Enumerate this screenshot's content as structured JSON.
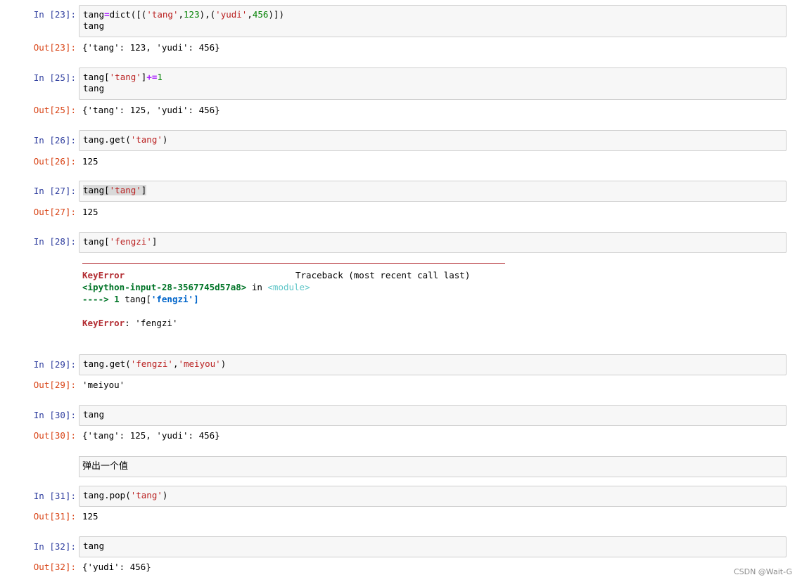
{
  "cells": {
    "c23": {
      "in_prompt": "In  [23]:",
      "line1": {
        "a": "tang",
        "op": "=",
        "b": "dict([(",
        "s1": "'tang'",
        "c": ",",
        "n1": "123",
        "d": "),(",
        "s2": "'yudi'",
        "e": ",",
        "n2": "456",
        "f": ")])"
      },
      "line2": "tang",
      "out_prompt": "Out[23]:",
      "output": "{'tang': 123, 'yudi': 456}"
    },
    "c25": {
      "in_prompt": "In  [25]:",
      "line1": {
        "a": "tang[",
        "s1": "'tang'",
        "b": "]",
        "op": "+=",
        "n1": "1"
      },
      "line2": "tang",
      "out_prompt": "Out[25]:",
      "output": "{'tang': 125, 'yudi': 456}"
    },
    "c26": {
      "in_prompt": "In  [26]:",
      "line1": {
        "a": "tang.get(",
        "s1": "'tang'",
        "b": ")"
      },
      "out_prompt": "Out[26]:",
      "output": "125"
    },
    "c27": {
      "in_prompt": "In  [27]:",
      "line1": {
        "a": "tang[",
        "s1": "'tang'",
        "b": "]"
      },
      "out_prompt": "Out[27]:",
      "output": "125"
    },
    "c28": {
      "in_prompt": "In  [28]:",
      "line1": {
        "a": "tang[",
        "s1": "'fengzi'",
        "b": "]"
      },
      "traceback": {
        "err_name": "KeyError",
        "tb_label": "Traceback (most recent call last)",
        "ipy_input": "<ipython-input-28-3567745d57a8>",
        "in_word": " in ",
        "module": "<module>",
        "arrow": "---->",
        "lineno": " 1 ",
        "code_a": "tang[",
        "code_s": "'fengzi'",
        "code_b": "]",
        "final_msg": ": 'fengzi'"
      }
    },
    "c29": {
      "in_prompt": "In  [29]:",
      "line1": {
        "a": "tang.get(",
        "s1": "'fengzi'",
        "c": ",",
        "s2": "'meiyou'",
        "b": ")"
      },
      "out_prompt": "Out[29]:",
      "output": "'meiyou'"
    },
    "c30": {
      "in_prompt": "In  [30]:",
      "line1": "tang",
      "out_prompt": "Out[30]:",
      "output": "{'tang': 125, 'yudi': 456}"
    },
    "markdown": "弹出一个值",
    "c31": {
      "in_prompt": "In  [31]:",
      "line1": {
        "a": "tang.pop(",
        "s1": "'tang'",
        "b": ")"
      },
      "out_prompt": "Out[31]:",
      "output": "125"
    },
    "c32": {
      "in_prompt": "In  [32]:",
      "line1": "tang",
      "out_prompt": "Out[32]:",
      "output": "{'yudi': 456}"
    }
  },
  "watermark": "CSDN @Wait-G",
  "colors": {
    "in_prompt": "#303f9f",
    "out_prompt": "#d84315",
    "string": "#ba2121",
    "number": "#008000",
    "operator": "#aa22ff",
    "error": "#b22b31"
  }
}
